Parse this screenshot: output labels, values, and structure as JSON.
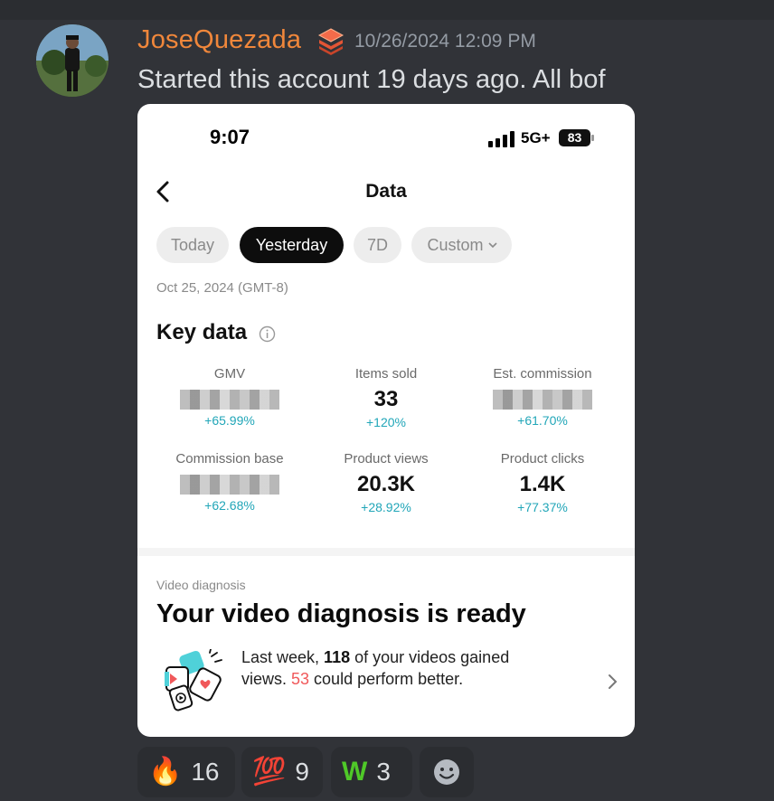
{
  "message": {
    "username": "JoseQuezada",
    "role_icon": "layers-icon",
    "timestamp": "10/26/2024 12:09 PM",
    "text": "Started this account 19 days ago. All bof"
  },
  "screenshot": {
    "status": {
      "time": "9:07",
      "network": "5G+",
      "battery": "83"
    },
    "nav": {
      "title": "Data"
    },
    "tabs": [
      {
        "label": "Today",
        "active": false
      },
      {
        "label": "Yesterday",
        "active": true
      },
      {
        "label": "7D",
        "active": false
      },
      {
        "label": "Custom",
        "active": false
      }
    ],
    "date_range": "Oct 25, 2024 (GMT-8)",
    "key_data": {
      "title": "Key data",
      "metrics": [
        {
          "label": "GMV",
          "value": null,
          "blurred": true,
          "delta": "+65.99%"
        },
        {
          "label": "Items sold",
          "value": "33",
          "blurred": false,
          "delta": "+120%"
        },
        {
          "label": "Est. commission",
          "value": null,
          "blurred": true,
          "delta": "+61.70%"
        },
        {
          "label": "Commission base",
          "value": null,
          "blurred": true,
          "delta": "+62.68%"
        },
        {
          "label": "Product views",
          "value": "20.3K",
          "blurred": false,
          "delta": "+28.92%"
        },
        {
          "label": "Product clicks",
          "value": "1.4K",
          "blurred": false,
          "delta": "+77.37%"
        }
      ]
    },
    "video_diagnosis": {
      "label": "Video diagnosis",
      "title": "Your video diagnosis is ready",
      "line1_prefix": "Last week, ",
      "line1_count": "118",
      "line1_suffix": " of your videos gained",
      "line2_prefix": "views. ",
      "line2_count": "53",
      "line2_suffix": " could perform better."
    }
  },
  "reactions": [
    {
      "emoji": "🔥",
      "icon": "fire-icon",
      "count": "16"
    },
    {
      "emoji": "💯",
      "icon": "hundred-icon",
      "count": "9"
    },
    {
      "emoji": "W",
      "icon": "w-letter-icon",
      "count": "3"
    },
    {
      "emoji": "",
      "icon": "add-reaction-icon",
      "count": ""
    }
  ],
  "colors": {
    "background": "#313338",
    "username": "#f0873b",
    "delta": "#21a6b8",
    "highlight_red": "#f0585a"
  }
}
